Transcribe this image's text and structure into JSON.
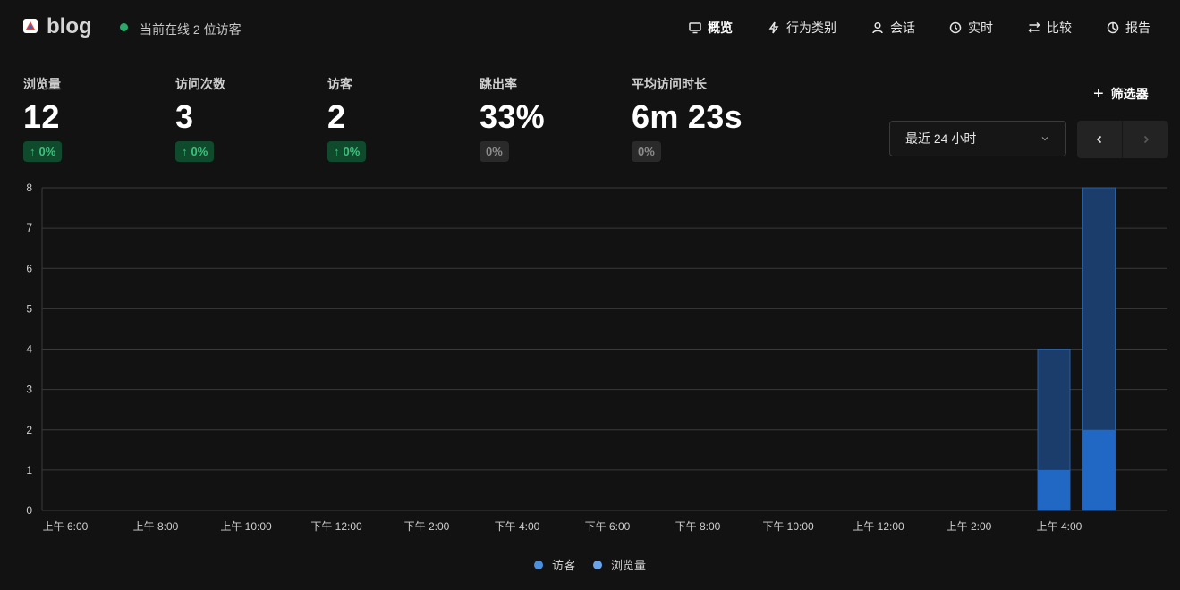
{
  "header": {
    "site_name": "blog",
    "online_text": "当前在线 2 位访客"
  },
  "nav": {
    "overview": "概览",
    "events": "行为类别",
    "sessions": "会话",
    "realtime": "实时",
    "compare": "比较",
    "reports": "报告"
  },
  "metrics": [
    {
      "label": "浏览量",
      "value": "12",
      "change": "0%",
      "trend": "up"
    },
    {
      "label": "访问次数",
      "value": "3",
      "change": "0%",
      "trend": "up"
    },
    {
      "label": "访客",
      "value": "2",
      "change": "0%",
      "trend": "up"
    },
    {
      "label": "跳出率",
      "value": "33%",
      "change": "0%",
      "trend": "flat"
    },
    {
      "label": "平均访问时长",
      "value": "6m 23s",
      "change": "0%",
      "trend": "flat"
    }
  ],
  "filter_label": "筛选器",
  "date_range": "最近 24 小时",
  "colors": {
    "up_text": "#3cc27b",
    "up_bg": "#0e4a2b",
    "visitors": "#2168c4",
    "pageviews": "#1b3d6b"
  },
  "chart_data": {
    "type": "bar",
    "stacked_overlay": true,
    "x_labels": [
      "上午 6:00",
      "上午 8:00",
      "上午 10:00",
      "下午 12:00",
      "下午 2:00",
      "下午 4:00",
      "下午 6:00",
      "下午 8:00",
      "下午 10:00",
      "上午 12:00",
      "上午 2:00",
      "上午 4:00"
    ],
    "ylim": [
      0,
      8
    ],
    "y_ticks": [
      0,
      1,
      2,
      3,
      4,
      5,
      6,
      7,
      8
    ],
    "grid": true,
    "legend_position": "bottom-center",
    "series": [
      {
        "name": "访客",
        "color": "#4a8fe0",
        "points": [
          {
            "x": "上午 4:00",
            "value": 1
          },
          {
            "x": "上午 5:00",
            "value": 2
          }
        ]
      },
      {
        "name": "浏览量",
        "color": "#6aa4ea",
        "points": [
          {
            "x": "上午 4:00",
            "value": 4
          },
          {
            "x": "上午 5:00",
            "value": 8
          }
        ]
      }
    ]
  }
}
